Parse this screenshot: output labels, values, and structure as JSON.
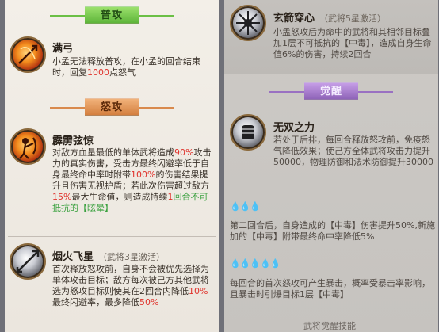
{
  "left": {
    "banner_normal": "普攻",
    "banner_rage": "怒攻",
    "skills": [
      {
        "name": "满弓",
        "tag": "",
        "icon": "fire-bow-icon",
        "desc_parts": [
          "小孟无法释放普攻，在小孟的回合结束时，回复",
          "1000",
          "点怒气"
        ]
      },
      {
        "name": "霹雳弦惊",
        "tag": "",
        "icon": "fire-archer-icon",
        "desc_parts": [
          "对敌方血量最低的单体武将造成",
          "90%",
          "攻击力的真实伤害，受击方最终闪避率低于自身最终命中率时附带",
          "100%",
          "的伤害结果提升且伤害无视护盾；若此次伤害超过敌方",
          "15%",
          "最大生命值，则造成持续",
          "1",
          "回合不可抵抗的【",
          "眩晕",
          "】"
        ]
      },
      {
        "name": "烟火飞星",
        "tag": "（武将3星激活）",
        "icon": "silver-arrow-icon",
        "desc_parts": [
          "首次释放怒攻前，自身不会被优先选择为单体攻击目标；敌方每次被己方其他武将选为怒攻目标则使其在2回合内降低",
          "10%",
          "最终闪避率，最多降低",
          "50%"
        ]
      }
    ]
  },
  "right": {
    "banner_awaken": "觉醒",
    "skills": [
      {
        "name": "玄箭穿心",
        "tag": "（武将5星激活）",
        "icon": "silver-burst-icon",
        "desc": "小孟怒攻后为命中的武将和其相邻目标叠加1层不可抵抗的【中毒】，造成自身生命值6%的伤害，持续2回合"
      },
      {
        "name": "无双之力",
        "tag": "",
        "icon": "silver-fist-icon",
        "desc": "若处于后排，每回合释放怒攻前，免疫怒气降低效果；使己方全体武将攻击力提升50000，物理防御和法术防御提升30000"
      }
    ],
    "tier2_drops": "💧💧💧",
    "tier2_desc": "第二回合后，自身造成的【中毒】伤害提升50%,新施加的【中毒】附带最终命中率降低5%",
    "tier3_drops": "💧💧💧💧💧",
    "tier3_desc": "每回合的首次怒攻可产生暴击，概率受暴击率影响，且暴击时引爆目标1层【中毒】",
    "footer": "武将觉醒技能"
  }
}
